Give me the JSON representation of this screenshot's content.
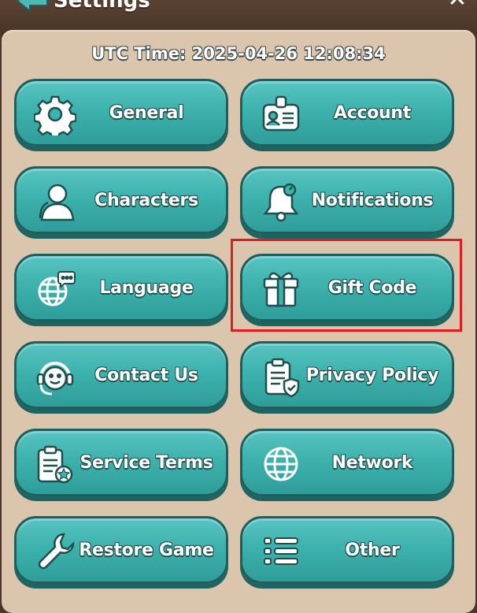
{
  "header": {
    "title": "Settings",
    "close_symbol": "✕",
    "back_icon": "back-arrow-icon"
  },
  "utc": {
    "label": "UTC Time:",
    "value": "2025-04-26 12:08:34"
  },
  "buttons": [
    {
      "label": "General",
      "icon": "gear-icon"
    },
    {
      "label": "Account",
      "icon": "id-badge-icon"
    },
    {
      "label": "Characters",
      "icon": "user-silhouette-icon"
    },
    {
      "label": "Notifications",
      "icon": "bell-icon"
    },
    {
      "label": "Language",
      "icon": "globe-chat-icon"
    },
    {
      "label": "Gift Code",
      "icon": "gift-icon"
    },
    {
      "label": "Contact Us",
      "icon": "headset-icon"
    },
    {
      "label": "Privacy Policy",
      "icon": "clipboard-shield-icon"
    },
    {
      "label": "Service Terms",
      "icon": "clipboard-badge-icon"
    },
    {
      "label": "Network",
      "icon": "globe-icon"
    },
    {
      "label": "Restore Game",
      "icon": "wrench-icon"
    },
    {
      "label": "Other",
      "icon": "list-icon"
    }
  ],
  "colors": {
    "button": "#3eb2ae",
    "button_border": "#1e5e5c",
    "panel": "#dcc5ad",
    "highlight": "#e21b23"
  }
}
